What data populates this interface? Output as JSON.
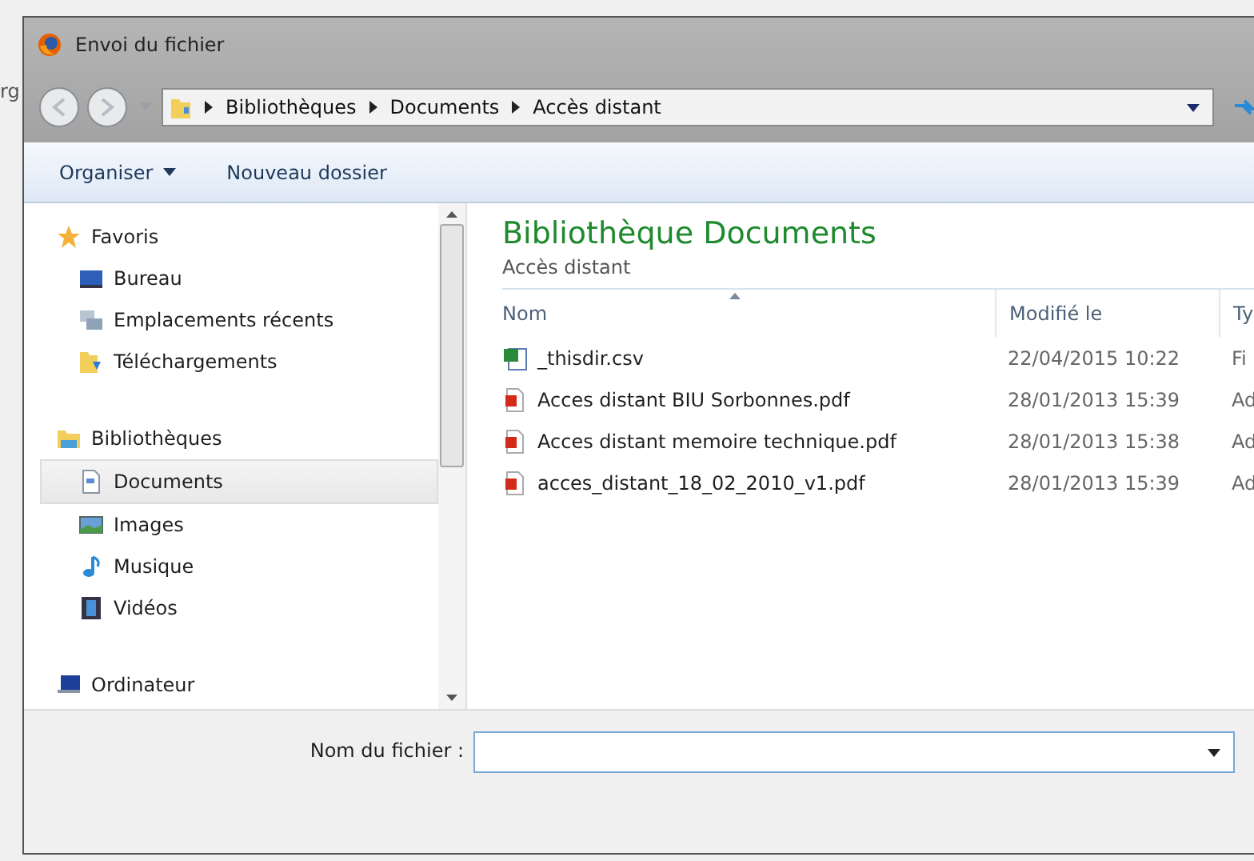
{
  "background_fragments": [
    "rg"
  ],
  "window": {
    "title": "Envoi du fichier"
  },
  "address_bar": {
    "path": [
      "Bibliothèques",
      "Documents",
      "Accès distant"
    ]
  },
  "toolbar": {
    "buttons": [
      {
        "label": "Organiser",
        "kind": "menu"
      },
      {
        "label": "Nouveau dossier",
        "kind": "plain"
      }
    ]
  },
  "sidebar": {
    "groups": [
      {
        "label": "Favoris",
        "kind": "star",
        "children": [
          {
            "label": "Bureau",
            "kind": "desktop",
            "selected": false
          },
          {
            "label": "Emplacements récents",
            "kind": "recent",
            "selected": false
          },
          {
            "label": "Téléchargements",
            "kind": "download",
            "selected": false
          }
        ]
      },
      {
        "label": "Bibliothèques",
        "kind": "library",
        "children": [
          {
            "label": "Documents",
            "kind": "document",
            "selected": true
          },
          {
            "label": "Images",
            "kind": "image",
            "selected": false
          },
          {
            "label": "Musique",
            "kind": "music",
            "selected": false
          },
          {
            "label": "Vidéos",
            "kind": "video",
            "selected": false
          }
        ]
      },
      {
        "label": "Ordinateur",
        "kind": "computer"
      }
    ]
  },
  "content": {
    "title": "Bibliothèque Documents",
    "subtitle": "Accès distant",
    "columns": [
      "Nom",
      "Modifié le",
      "Ty"
    ],
    "rows": [
      {
        "kind": "csv",
        "name": "_thisdir.csv",
        "modified": "22/04/2015 10:22",
        "type": "Fi"
      },
      {
        "kind": "pdf",
        "name": "Acces distant BIU Sorbonnes.pdf",
        "modified": "28/01/2013 15:39",
        "type": "Ad"
      },
      {
        "kind": "pdf",
        "name": "Acces distant memoire technique.pdf",
        "modified": "28/01/2013 15:38",
        "type": "Ad"
      },
      {
        "kind": "pdf",
        "name": "acces_distant_18_02_2010_v1.pdf",
        "modified": "28/01/2013 15:39",
        "type": "Ad"
      }
    ]
  },
  "filename": {
    "label": "Nom du fichier :"
  }
}
